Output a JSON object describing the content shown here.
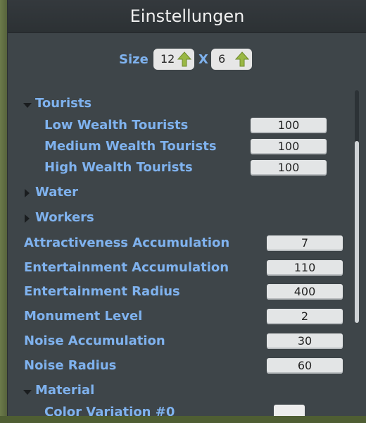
{
  "window": {
    "title": "Einstellungen"
  },
  "size": {
    "label": "Size",
    "width": "12",
    "separator": "X",
    "height": "6"
  },
  "groups": {
    "tourists": {
      "label": "Tourists",
      "items": [
        {
          "label": "Low Wealth Tourists",
          "value": "100"
        },
        {
          "label": "Medium Wealth Tourists",
          "value": "100"
        },
        {
          "label": "High Wealth Tourists",
          "value": "100"
        }
      ]
    },
    "water": {
      "label": "Water"
    },
    "workers": {
      "label": "Workers"
    },
    "material": {
      "label": "Material",
      "first_item": "Color Variation #0"
    }
  },
  "settings": [
    {
      "label": "Attractiveness Accumulation",
      "value": "7"
    },
    {
      "label": "Entertainment Accumulation",
      "value": "110"
    },
    {
      "label": "Entertainment Radius",
      "value": "400"
    },
    {
      "label": "Monument Level",
      "value": "2"
    },
    {
      "label": "Noise Accumulation",
      "value": "30"
    },
    {
      "label": "Noise Radius",
      "value": "60"
    }
  ],
  "colors": {
    "label": "#7fb2ee",
    "panel": "#3e4549",
    "field": "#e3e5e6",
    "arrow": "#9ab845"
  },
  "icons": {
    "size_increment": "up-arrow-icon",
    "expand": "triangle-right-icon",
    "collapse": "triangle-down-icon"
  }
}
